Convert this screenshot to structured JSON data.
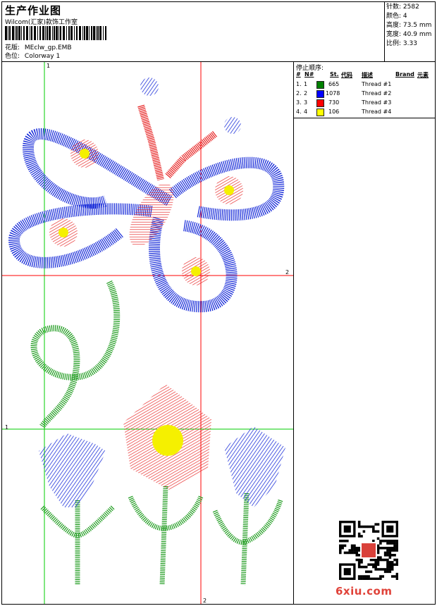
{
  "header": {
    "title": "生产作业图",
    "company": "Wilcom(汇家)款饰工作室",
    "design_label": "花版:",
    "design_value": "MEclw_gp.EMB",
    "colorway_label": "色位:",
    "colorway_value": "Colorway 1"
  },
  "stats": [
    {
      "label": "针数:",
      "value": "2582"
    },
    {
      "label": "颜色:",
      "value": "4"
    },
    {
      "label": "高度:",
      "value": "73.5 mm"
    },
    {
      "label": "宽度:",
      "value": "40.9 mm"
    },
    {
      "label": "比例:",
      "value": "3.33"
    }
  ],
  "stop_sequence": {
    "title": "停止顺序:",
    "columns": [
      "#",
      "N#",
      "St.",
      "代码",
      "描述",
      "Brand",
      "元素"
    ],
    "rows": [
      {
        "num": "1.",
        "n": "1",
        "color": "#008000",
        "stitches": "665",
        "desc": "Thread #1"
      },
      {
        "num": "2.",
        "n": "2",
        "color": "#0000ff",
        "stitches": "1078",
        "desc": "Thread #2"
      },
      {
        "num": "3.",
        "n": "3",
        "color": "#ff0000",
        "stitches": "730",
        "desc": "Thread #3"
      },
      {
        "num": "4.",
        "n": "4",
        "color": "#ffff00",
        "stitches": "106",
        "desc": "Thread #4"
      }
    ]
  },
  "guides": {
    "v1_label": "1",
    "v2_label": "2",
    "h1_label": "1",
    "h2_label": "2"
  },
  "watermark": "6xiu.com",
  "colors": {
    "green": "#1c9a1c",
    "blue": "#1428d8",
    "red": "#e61e1e",
    "yellow": "#f5f000",
    "guide_green": "#00cc00",
    "guide_red": "#ff0000"
  }
}
